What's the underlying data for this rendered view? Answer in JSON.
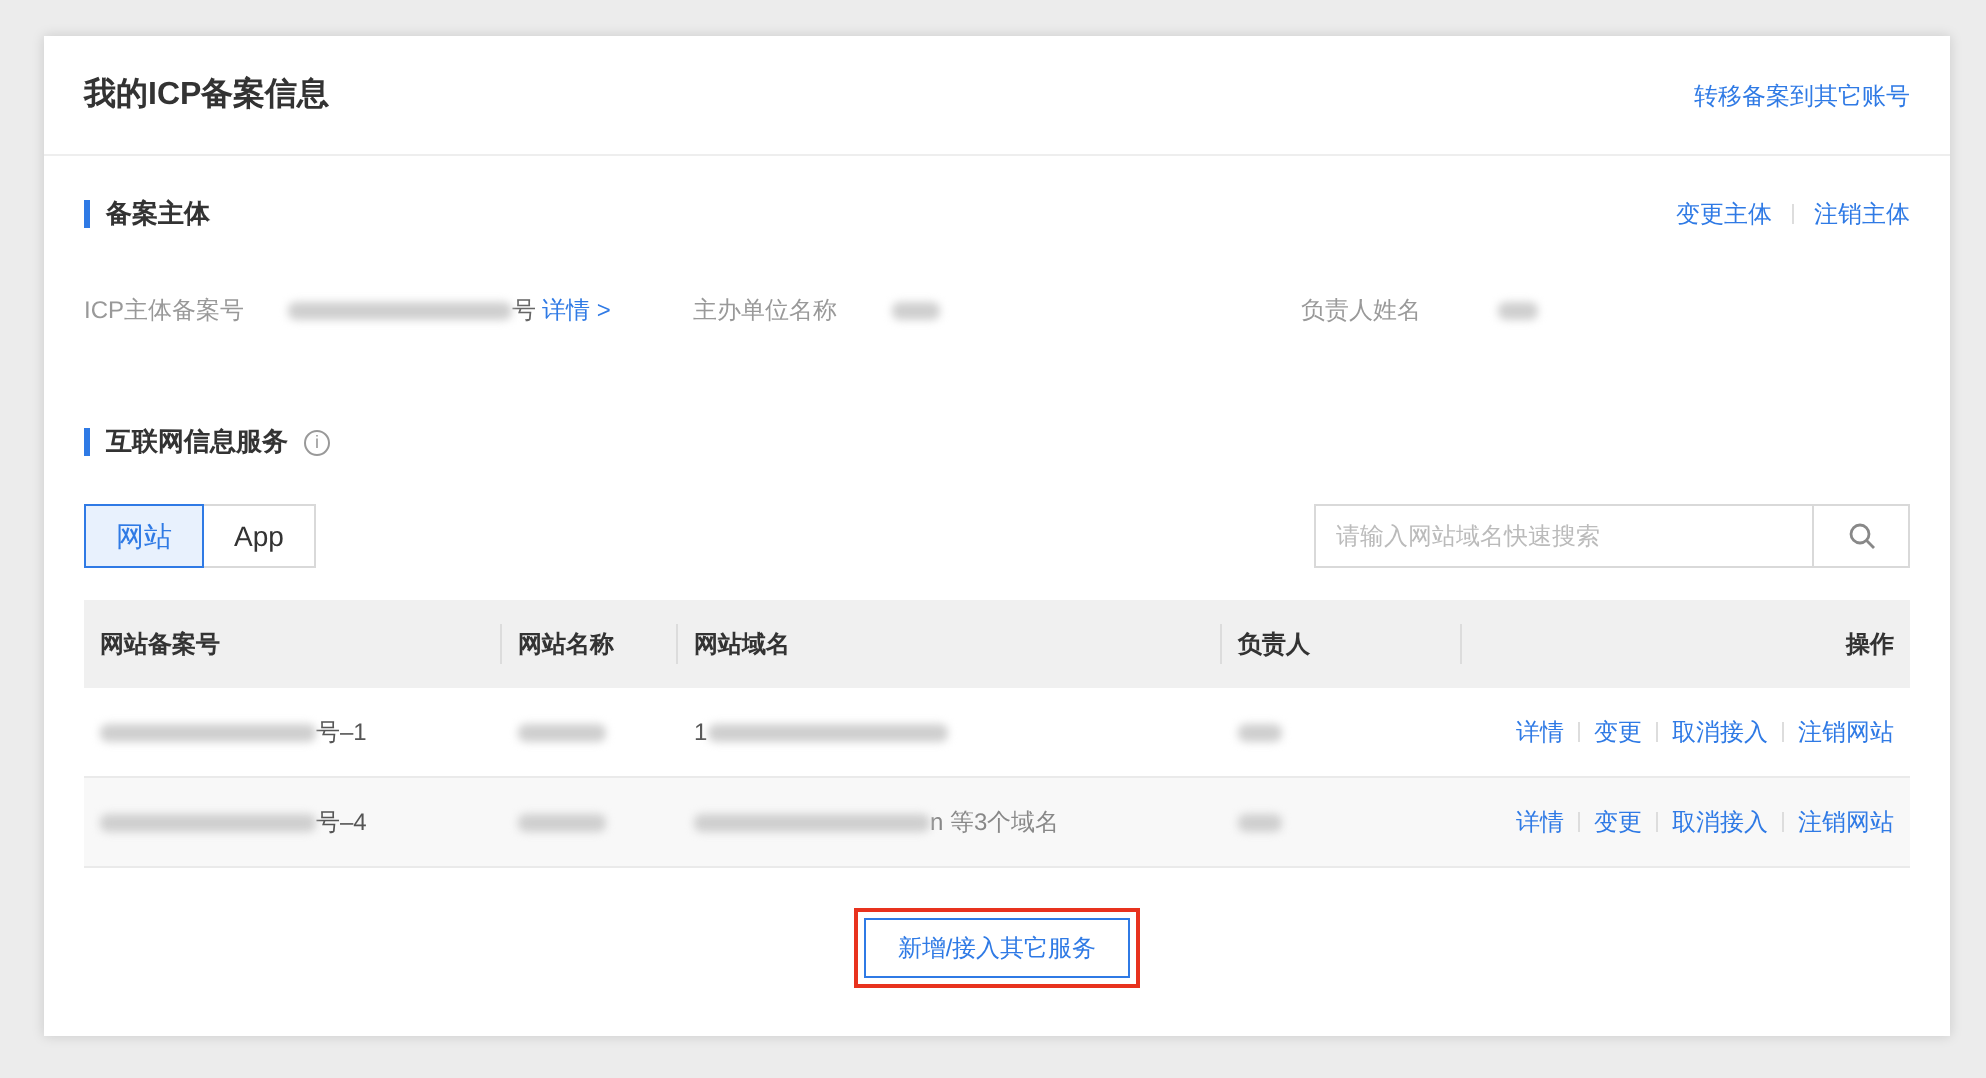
{
  "header": {
    "title": "我的ICP备案信息",
    "link": "转移备案到其它账号"
  },
  "subject": {
    "title": "备案主体",
    "actions": [
      "变更主体",
      "注销主体"
    ],
    "fields": [
      {
        "label": "ICP主体备案号",
        "value_tail": "号",
        "link": "详情 >"
      },
      {
        "label": "主办单位名称"
      },
      {
        "label": "负责人姓名"
      }
    ]
  },
  "services": {
    "title": "互联网信息服务",
    "info_icon": "i",
    "tabs": [
      {
        "label": "网站",
        "selected": true
      },
      {
        "label": "App",
        "selected": false
      }
    ],
    "search": {
      "placeholder": "请输入网站域名快速搜索"
    },
    "table": {
      "columns": [
        "网站备案号",
        "网站名称",
        "网站域名",
        "负责人",
        "操作"
      ],
      "rows": [
        {
          "number_tail": "号–1",
          "domain_head": "1",
          "domain_tail": "",
          "actions": [
            "详情",
            "变更",
            "取消接入",
            "注销网站"
          ]
        },
        {
          "number_tail": "号–4",
          "domain_head": "",
          "domain_tail": "n 等3个域名",
          "actions": [
            "详情",
            "变更",
            "取消接入",
            "注销网站"
          ]
        }
      ]
    },
    "add_button": "新增/接入其它服务"
  }
}
